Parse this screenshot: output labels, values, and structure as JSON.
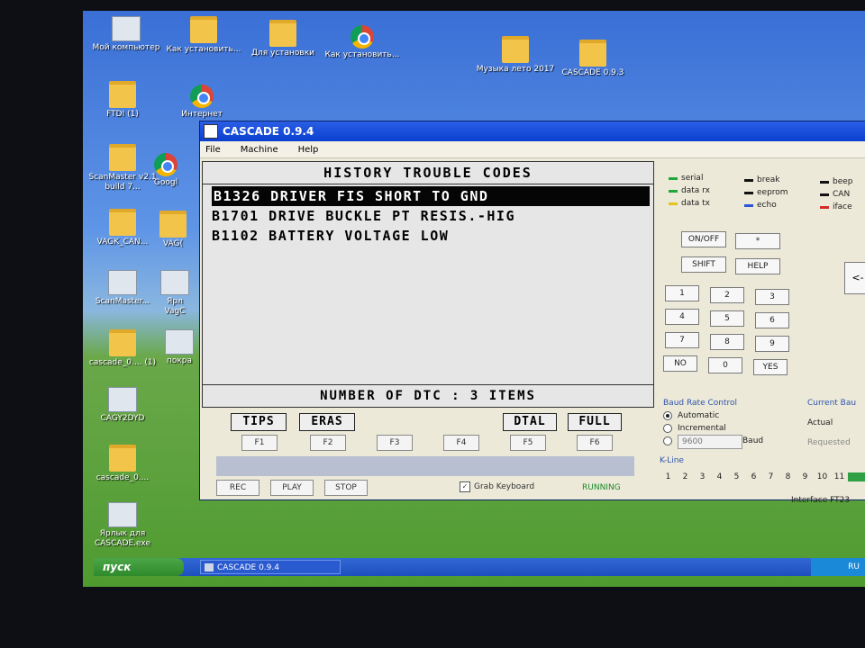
{
  "desktop": {
    "icons": [
      {
        "label": "Мой компьютер",
        "type": "generic"
      },
      {
        "label": "Как установить...",
        "type": "folder"
      },
      {
        "label": "Для установки",
        "type": "folder"
      },
      {
        "label": "Как установить...",
        "type": "chrome"
      },
      {
        "label": "Музыка лето 2017",
        "type": "folder"
      },
      {
        "label": "CASCADE 0.9.3",
        "type": "folder"
      },
      {
        "label": "FTDI (1)",
        "type": "folder"
      },
      {
        "label": "Интернет",
        "type": "chrome"
      },
      {
        "label": "ScanMaster v2.1 build 7...",
        "type": "folder"
      },
      {
        "label": "Googl",
        "type": "chrome"
      },
      {
        "label": "VAGK_CAN...",
        "type": "folder"
      },
      {
        "label": "VAG(",
        "type": "folder"
      },
      {
        "label": "ScanMaster...",
        "type": "generic"
      },
      {
        "label": "Ярл VagC",
        "type": "generic"
      },
      {
        "label": "cascade_0.... (1)",
        "type": "folder"
      },
      {
        "label": "покра",
        "type": "generic"
      },
      {
        "label": "CAGY2DYD",
        "type": "generic"
      },
      {
        "label": "cascade_0....",
        "type": "folder"
      },
      {
        "label": "Ярлык для CASCADE.exe",
        "type": "generic"
      }
    ]
  },
  "window": {
    "title": "CASCADE 0.9.4",
    "menu": [
      "File",
      "Machine",
      "Help"
    ],
    "display": {
      "title": "HISTORY TROUBLE CODES",
      "codes": [
        "B1326 DRIVER FIS SHORT TO GND",
        "B1701 DRIVE BUCKLE PT RESIS.-HIG",
        "B1102 BATTERY VOLTAGE LOW"
      ],
      "selected_index": 0,
      "footer": "NUMBER OF DTC  :  3 ITEMS"
    },
    "soft_labels": [
      "TIPS",
      "ERAS",
      "DTAL",
      "FULL"
    ],
    "fkeys": [
      "F1",
      "F2",
      "F3",
      "F4",
      "F5",
      "F6"
    ],
    "controls": {
      "rec": "REC",
      "play": "PLAY",
      "stop": "STOP"
    },
    "grab_keyboard": "Grab Keyboard",
    "status": "RUNNING",
    "legend": [
      {
        "label": "serial",
        "color": "#1fa83a"
      },
      {
        "label": "data rx",
        "color": "#1fa83a"
      },
      {
        "label": "data tx",
        "color": "#e6c21a"
      },
      {
        "label": "break",
        "color": "#111111"
      },
      {
        "label": "eeprom",
        "color": "#111111"
      },
      {
        "label": "echo",
        "color": "#2a55d6"
      },
      {
        "label": "beep",
        "color": "#111111"
      },
      {
        "label": "CAN",
        "color": "#111111"
      },
      {
        "label": "iface",
        "color": "#d62a2a"
      }
    ],
    "keypad": {
      "onoff": "ON/OFF",
      "star": "*",
      "shift": "SHIFT",
      "help": "HELP",
      "digits": [
        "1",
        "2",
        "3",
        "4",
        "5",
        "6",
        "7",
        "8",
        "9"
      ],
      "no": "NO",
      "zero": "0",
      "yes": "YES",
      "back": "<-"
    },
    "baud": {
      "title": "Baud Rate Control",
      "automatic": "Automatic",
      "incremental": "Incremental",
      "value": "9600",
      "unit": "Baud",
      "current_title": "Current Bau",
      "actual": "Actual",
      "requested": "Requested"
    },
    "kline": {
      "title": "K-Line",
      "pins": [
        "1",
        "2",
        "3",
        "4",
        "5",
        "6",
        "7",
        "8",
        "9",
        "10",
        "11"
      ]
    },
    "interface": "Interface  FT23"
  },
  "taskbar": {
    "start": "пуск",
    "item": "CASCADE 0.9.4",
    "tray": "RU"
  }
}
